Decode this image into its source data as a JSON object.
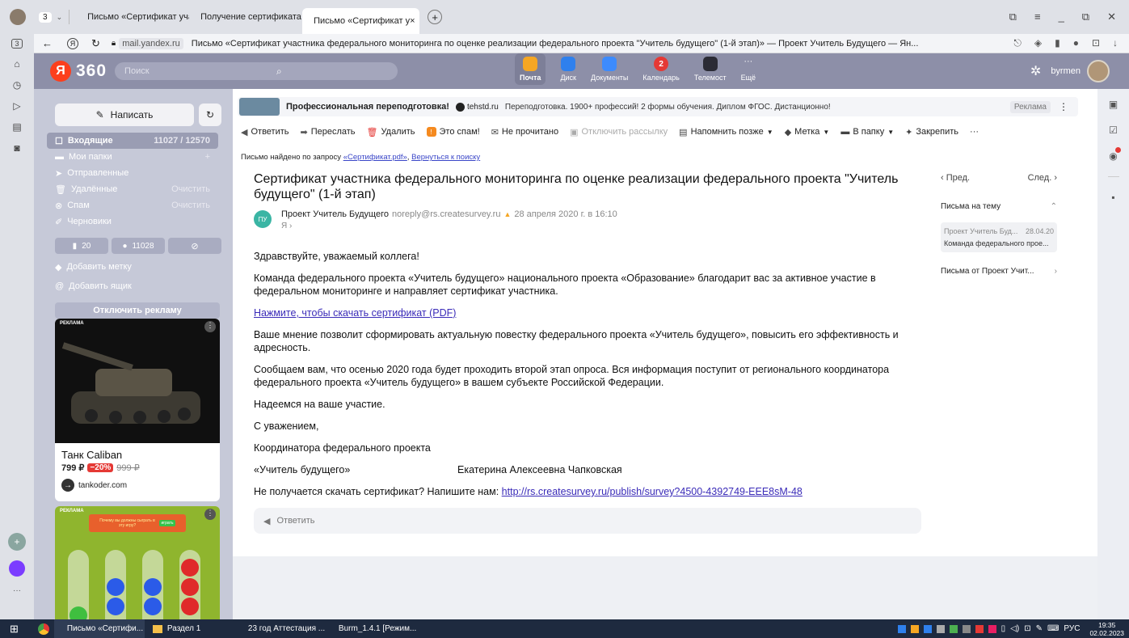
{
  "browser": {
    "tab_counter": "3",
    "tabs": [
      {
        "label": "Письмо «Сертификат учас"
      },
      {
        "label": "Получение сертификата -"
      },
      {
        "label": "Письмо «Сертификат у"
      }
    ],
    "url_domain": "mail.yandex.ru",
    "page_title": "Письмо «Сертификат участника федерального мониторинга по оценке реализации федерального проекта \"Учитель будущего\" (1-й этап)» — Проект Учитель Будущего — Ян..."
  },
  "header": {
    "logo_letter": "Я",
    "logo_text": "360",
    "search_placeholder": "Поиск",
    "apps": [
      {
        "label": "Почта",
        "color": "#f5a623",
        "icon": "mail-icon"
      },
      {
        "label": "Диск",
        "color": "#2f80ed",
        "icon": "disk-icon"
      },
      {
        "label": "Документы",
        "color": "#3d8bfd",
        "icon": "documents-icon"
      },
      {
        "label": "Календарь",
        "color": "#e53935",
        "icon": "calendar-icon",
        "badge": "2"
      },
      {
        "label": "Телемост",
        "color": "#2b2b35",
        "icon": "telemost-icon"
      },
      {
        "label": "Ещё",
        "color": "#8d8fa8",
        "icon": "more-icon"
      }
    ],
    "username": "byrmen"
  },
  "sidebar": {
    "compose": "Написать",
    "folders": [
      {
        "label": "Входящие",
        "count": "11027 / 12570",
        "icon": "inbox-icon"
      },
      {
        "label": "Мои папки",
        "count": "+",
        "icon": "folder-icon"
      },
      {
        "label": "Отправленные",
        "count": "",
        "icon": "sent-icon"
      },
      {
        "label": "Удалённые",
        "count": "Очистить",
        "icon": "trash-icon"
      },
      {
        "label": "Спам",
        "count": "Очистить",
        "icon": "spam-icon"
      },
      {
        "label": "Черновики",
        "count": "",
        "icon": "drafts-icon"
      }
    ],
    "filter_flag": "20",
    "filter_unread": "11028",
    "add_label": "Добавить метку",
    "add_box": "Добавить ящик",
    "disable_ads": "Отключить рекламу"
  },
  "ads": {
    "ad_label": "РЕКЛАМА",
    "product_title": "Танк Caliban",
    "price": "799 ₽",
    "discount": "−20%",
    "old_price": "999 ₽",
    "site": "tankoder.com",
    "ad2_label": "РЕКЛАМА",
    "ad2_text": "Почему вы должны сыграть в эту игру?",
    "ad2_button": "играть"
  },
  "banner": {
    "title": "Профессиональная переподготовка!",
    "domain": "tehstd.ru",
    "text": "Переподготовка. 1900+ профессий! 2 формы обучения. Диплом ФГОС. Дистанционно!",
    "badge": "Реклама"
  },
  "toolbar": {
    "reply": "Ответить",
    "forward": "Переслать",
    "delete": "Удалить",
    "spam": "Это спам!",
    "unread": "Не прочитано",
    "unsubscribe": "Отключить рассылку",
    "remind": "Напомнить позже",
    "label": "Метка",
    "folder": "В папку",
    "pin": "Закрепить",
    "more": "···"
  },
  "search_notice": {
    "prefix": "Письмо найдено по запросу",
    "query": "«Сертификат.pdf»",
    "back": "Вернуться к поиску"
  },
  "email": {
    "subject": "Сертификат участника федерального мониторинга по оценке реализации федерального проекта \"Учитель будущего\" (1-й этап)",
    "avatar": "ПУ",
    "sender_name": "Проект Учитель Будущего",
    "sender_email": "noreply@rs.createsurvey.ru",
    "date": "28 апреля 2020 г. в 16:10",
    "to": "Я",
    "greeting": "Здравствуйте, уважаемый коллега!",
    "p1": "Команда федерального проекта «Учитель будущего» национального проекта «Образование» благодарит вас за активное участие в федеральном мониторинге и направляет сертификат участника.",
    "link": "Нажмите, чтобы скачать сертификат (PDF)",
    "p2": "Ваше мнение позволит сформировать актуальную повестку федерального проекта «Учитель будущего», повысить его эффективность и адресность.",
    "p3": "Сообщаем вам, что осенью 2020 года будет проходить второй этап опроса. Вся информация поступит от регионального координатора федерального проекта «Учитель будущего» в вашем субъекте Российской Федерации.",
    "p4": "Надеемся на ваше участие.",
    "p5": "С уважением,",
    "p6": "Координатора федерального проекта",
    "sig_left": "«Учитель будущего»",
    "sig_right": "Екатерина Алексеевна Чапковская",
    "help_prefix": "Не получается скачать сертификат? Напишите нам:",
    "help_link": "http://rs.createsurvey.ru/publish/survey?4500-4392749-EEE8sM-48",
    "reply_box": "Ответить"
  },
  "thread": {
    "prev": "‹ Пред.",
    "next": "След. ›",
    "on_topic": "Письма на тему",
    "item_sender": "Проект Учитель Буд...",
    "item_date": "28.04.20",
    "item_subject": "Команда федерального прое...",
    "from_sender": "Письма от Проект Учит..."
  },
  "taskbar": {
    "items": [
      "Письмо «Сертифи...",
      "Раздел 1",
      "23 год Аттестация ...",
      "Burm_1.4.1 [Режим..."
    ],
    "lang": "РУС",
    "time": "19:35",
    "date": "02.02.2023"
  }
}
